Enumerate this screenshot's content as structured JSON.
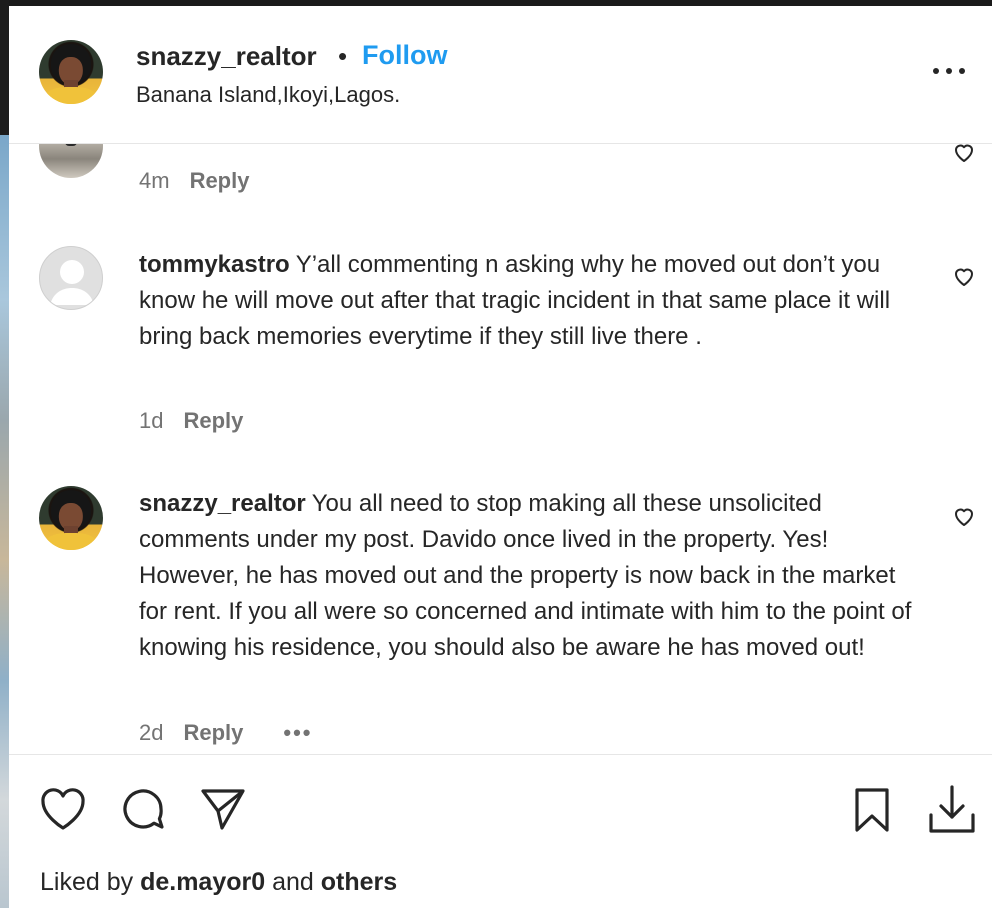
{
  "header": {
    "username": "snazzy_realtor",
    "separator": "•",
    "follow_label": "Follow",
    "location": "Banana Island,Ikoyi,Lagos.",
    "more_icon": "more-horizontal-icon"
  },
  "comments": {
    "partial": {
      "time": "4m",
      "reply_label": "Reply"
    },
    "items": [
      {
        "username": "tommykastro",
        "text": "Y’all commenting n asking why he moved out don’t you know he will move out after that tragic incident in that same place it will bring back memories everytime if they still live there .",
        "time": "1d",
        "reply_label": "Reply"
      },
      {
        "username": "snazzy_realtor",
        "text": "You all need to stop making all these unsolicited comments under my post. Davido once lived in the property. Yes! However, he has moved out and the property is now back in the market for rent. If you all were so concerned and intimate with him to the point of knowing his residence, you should also be aware he has moved out!",
        "time": "2d",
        "reply_label": "Reply",
        "more_label": "•••"
      }
    ]
  },
  "actions": {
    "icons": [
      "heart-icon",
      "comment-icon",
      "share-icon",
      "bookmark-icon",
      "download-icon"
    ]
  },
  "likes": {
    "prefix": "Liked by",
    "user": "de.mayor0",
    "conj": "and",
    "others": "others"
  },
  "colors": {
    "accent": "#1f9bf0",
    "text": "#262626",
    "muted": "#737373"
  }
}
